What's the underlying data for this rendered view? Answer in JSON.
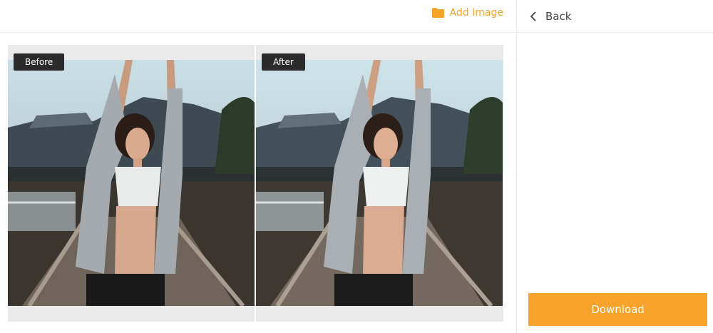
{
  "header": {
    "add_image_label": "Add Image"
  },
  "sidebar": {
    "back_label": "Back",
    "download_label": "Download"
  },
  "compare": {
    "before_label": "Before",
    "after_label": "After"
  },
  "colors": {
    "accent": "#f7a32b",
    "tag_bg": "#2b2b2b",
    "canvas_bg": "#eaeaea"
  },
  "icons": {
    "add_image": "folder-icon",
    "back": "chevron-left-icon"
  }
}
